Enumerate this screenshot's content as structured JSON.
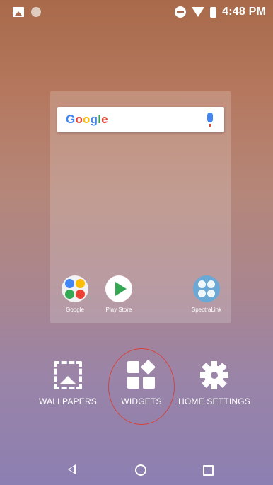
{
  "status_bar": {
    "time": "4:48 PM",
    "icons": [
      "gallery-icon",
      "notification-dot-icon",
      "do-not-disturb-icon",
      "wifi-icon",
      "battery-charging-icon"
    ]
  },
  "preview": {
    "search_logo": "Google",
    "apps": [
      {
        "label": "Google",
        "icon": "google-folder-icon"
      },
      {
        "label": "Play Store",
        "icon": "play-store-icon"
      },
      {
        "label": "SpectraLink",
        "icon": "spectralink-folder-icon"
      }
    ]
  },
  "options": {
    "wallpapers": "WALLPAPERS",
    "widgets": "WIDGETS",
    "home_settings": "HOME SETTINGS"
  },
  "colors": {
    "google_blue": "#4285f4",
    "google_red": "#ea4335",
    "google_yellow": "#fbbc05",
    "google_green": "#34a853",
    "highlight": "#d6423b"
  }
}
